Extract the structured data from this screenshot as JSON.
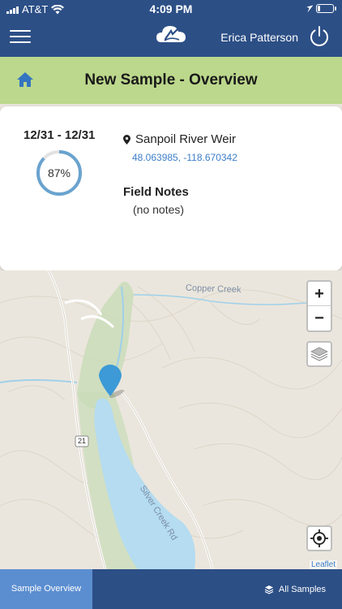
{
  "status_bar": {
    "carrier": "AT&T",
    "time": "4:09 PM",
    "battery_level": 0.2
  },
  "header": {
    "menu_icon": "hamburger-icon",
    "logo_icon": "cloud-logo-icon",
    "user_name": "Erica Patterson",
    "power_icon": "power-icon"
  },
  "title_bar": {
    "home_icon": "home-icon",
    "title": "New Sample - Overview"
  },
  "sample_card": {
    "date_range": "12/31 - 12/31",
    "progress_percent": 87,
    "progress_label": "87%",
    "site_name": "Sanpoil River Weir",
    "coordinates": "48.063985, -118.670342",
    "notes_heading": "Field Notes",
    "notes_value": "(no notes)"
  },
  "map": {
    "labels": {
      "creek": "Copper Creek",
      "road": "Silver Creek Rd",
      "route_shield": "21"
    },
    "zoom_in": "+",
    "zoom_out": "−",
    "attribution": "Leaflet",
    "marker_color": "#3d9ad6"
  },
  "bottom_bar": {
    "active_tab": "Sample Overview",
    "all_samples": "All Samples"
  },
  "colors": {
    "header_blue": "#2c4f86",
    "title_green": "#bcd88c",
    "gauge_blue": "#6aa3cf",
    "tab_active_blue": "#5b8ed0"
  }
}
